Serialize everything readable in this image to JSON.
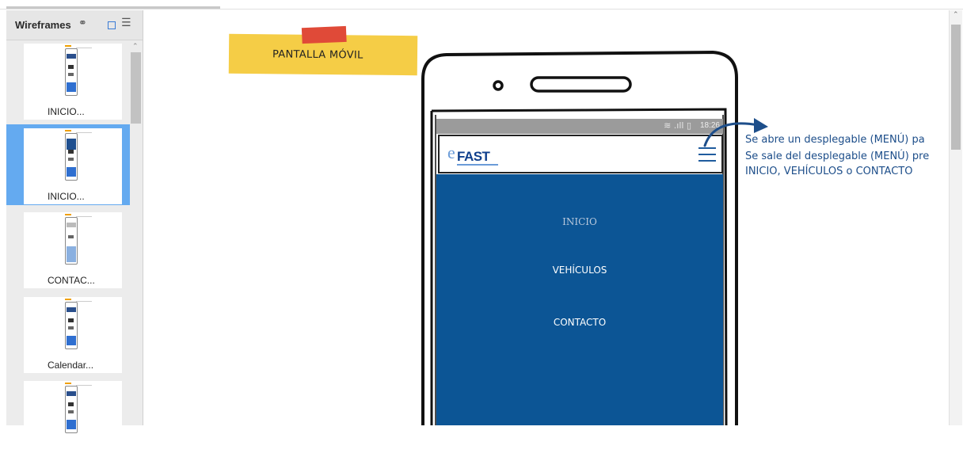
{
  "sidebar": {
    "title": "Wireframes",
    "link_icon": "link-icon",
    "view_icons": [
      "grid-view-icon",
      "list-view-icon"
    ],
    "items": [
      {
        "label": "INICIO..."
      },
      {
        "label": "INICIO...",
        "selected": true
      },
      {
        "label": "CONTAC..."
      },
      {
        "label": "Calendar..."
      },
      {
        "label": ""
      }
    ]
  },
  "canvas": {
    "sticky_note": "PANTALLA MÓVIL",
    "annotations": [
      "Se  abre un desplegable (MENÚ) pa",
      "Se sale del desplegable (MENÚ) pre",
      "INICIO, VEHÍCULOS o CONTACTO"
    ]
  },
  "phone": {
    "status_time": "18:26",
    "status_icons": "wifi-icon signal-icon battery-icon",
    "logo_e": "e",
    "logo_text": "FAST",
    "menu_icon": "hamburger-icon",
    "menu_items": [
      "INICIO",
      "VEHÍCULOS",
      "CONTACTO"
    ]
  },
  "colors": {
    "accent": "#0c5595",
    "sticky": "#f5cd46",
    "tape": "#e04a38",
    "annotation": "#1d4e8a",
    "selection": "#64aaf0"
  }
}
